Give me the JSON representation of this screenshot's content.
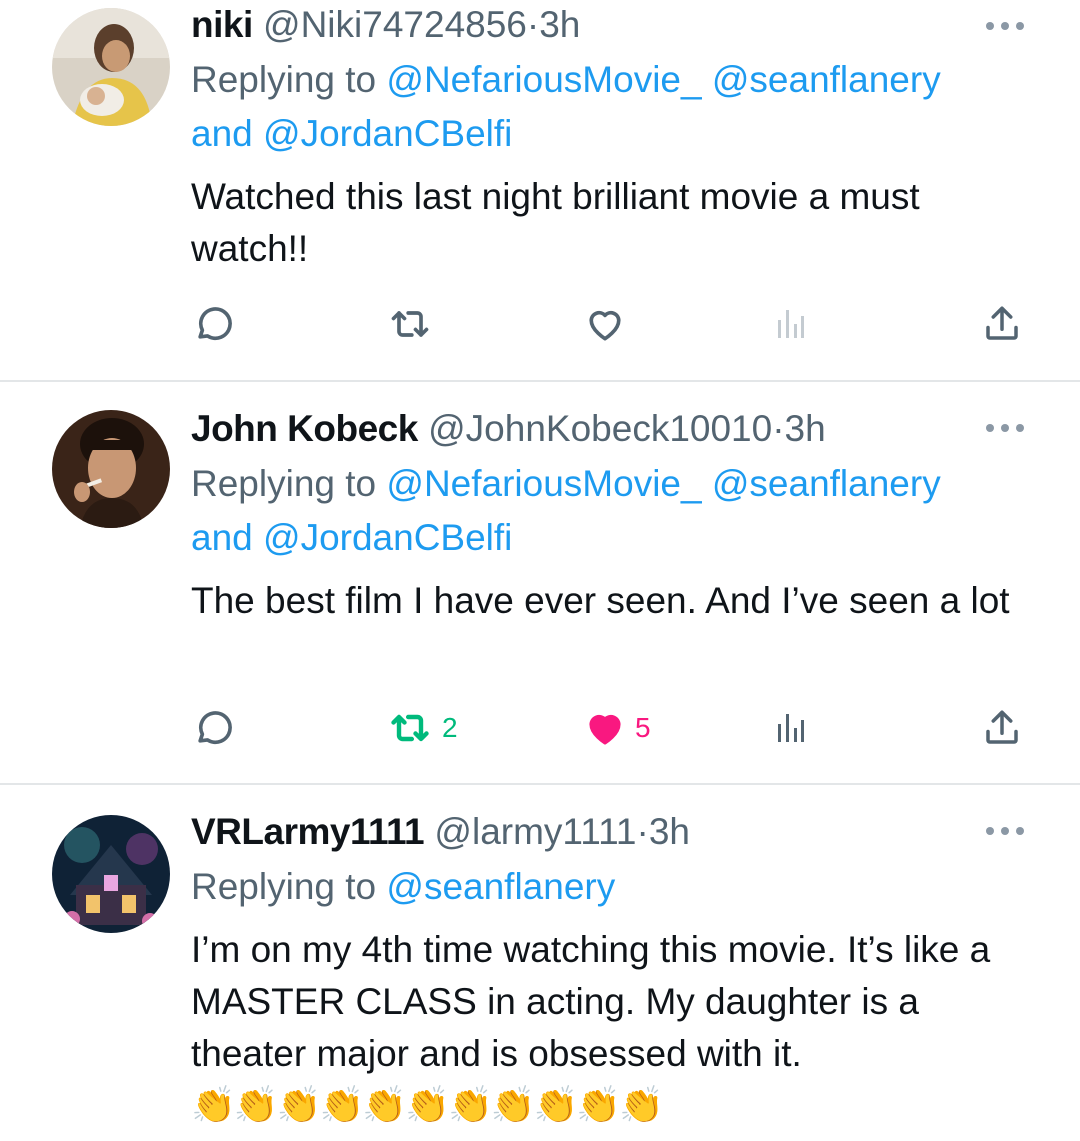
{
  "tweets": [
    {
      "name": "niki",
      "handle": "@Niki74724856",
      "dot": "·",
      "time": "3h",
      "replying_prefix": "Replying to ",
      "mention_1": "@NefariousMovie_",
      "mention_2": "@seanflanery",
      "mention_joiner": "and",
      "mention_3": "@JordanCBelfi",
      "text": "Watched this last night brilliant movie a must watch!!",
      "retweets": "",
      "likes": "",
      "liked": false
    },
    {
      "name": "John Kobeck",
      "handle": "@JohnKobeck10010",
      "dot": "·",
      "time": "3h",
      "replying_prefix": "Replying to ",
      "mention_1": "@NefariousMovie_",
      "mention_2": "@seanflanery",
      "mention_joiner": "and",
      "mention_3": "@JordanCBelfi",
      "text": "The best film I have ever seen. And I’ve seen a lot",
      "retweets": "2",
      "likes": "5",
      "liked": true
    },
    {
      "name": "VRLarmy1111",
      "handle": "@larmy1111",
      "dot": "·",
      "time": "3h",
      "replying_prefix": "Replying to ",
      "mention_1": "@seanflanery",
      "text": "I’m on my 4th time watching this movie. It’s like a MASTER CLASS in acting. My daughter is a theater major and is obsessed with it.",
      "emoji": "👏👏👏👏👏👏👏👏👏👏👏"
    }
  ],
  "icons": {
    "reply": "reply-icon",
    "retweet": "retweet-icon",
    "like": "heart-icon",
    "views": "views-icon",
    "share": "share-icon",
    "more": "more-icon"
  },
  "colors": {
    "text": "#0f1419",
    "secondary": "#536471",
    "link": "#1d9bf0",
    "retweet_green": "#00ba7c",
    "like_pink": "#f91880",
    "divider": "#e3e6e8"
  }
}
